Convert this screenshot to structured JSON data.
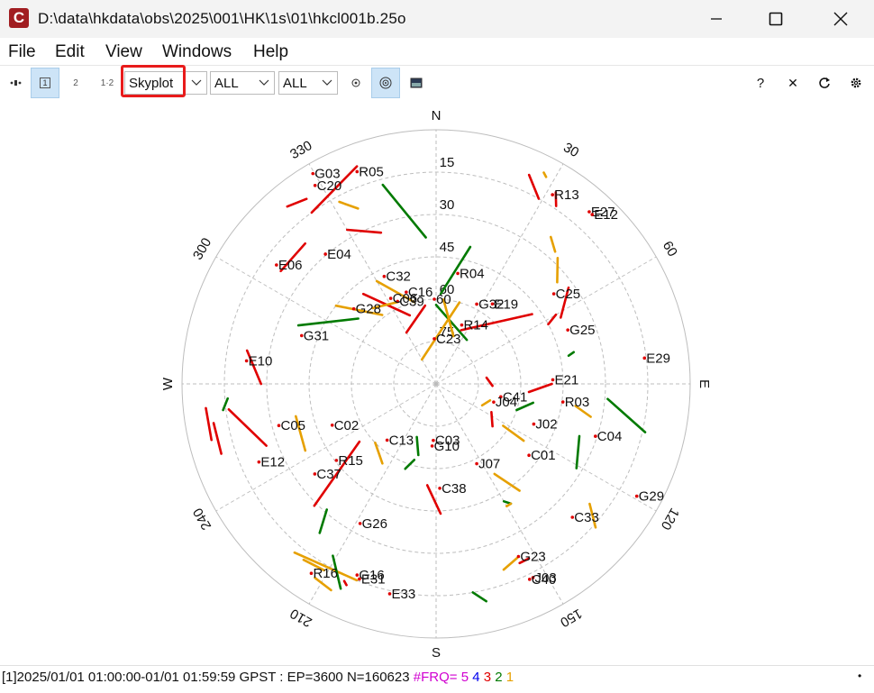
{
  "window": {
    "title": "D:\\data\\hkdata\\obs\\2025\\001\\HK\\1s\\01\\hkcl001b.25o",
    "icon_letter": "C",
    "minimize_icon": "minimize-icon",
    "maximize_icon": "maximize-icon",
    "close_icon": "close-icon"
  },
  "menu": [
    "File",
    "Edit",
    "View",
    "Windows",
    "Help"
  ],
  "toolbar": {
    "btn_1": "1",
    "btn_2": "2",
    "btn_12": "1·2",
    "plot_type": "Skyplot",
    "sat_filter": "ALL",
    "obs_filter": "ALL",
    "help": "?",
    "close": "✕"
  },
  "skyplot": {
    "directions": {
      "N": "N",
      "E": "E",
      "S": "S",
      "W": "W"
    },
    "azimuth_labels": [
      {
        "az": 30,
        "text": "30"
      },
      {
        "az": 60,
        "text": "60"
      },
      {
        "az": 120,
        "text": "120"
      },
      {
        "az": 150,
        "text": "150"
      },
      {
        "az": 210,
        "text": "210"
      },
      {
        "az": 240,
        "text": "240"
      },
      {
        "az": 300,
        "text": "300"
      },
      {
        "az": 330,
        "text": "330"
      }
    ],
    "elevation_labels": [
      {
        "el": 15,
        "text": "15"
      },
      {
        "el": 30,
        "text": "30"
      },
      {
        "el": 45,
        "text": "45"
      },
      {
        "el": 60,
        "text": "60"
      },
      {
        "el": 75,
        "text": "75"
      }
    ],
    "colors": {
      "g1": "#e00000",
      "g2": "#e6a000",
      "g3": "#007a00",
      "grid": "#bdbdbd"
    },
    "tracks": [
      {
        "c": "g1",
        "pts": [
          [
            324,
            15
          ],
          [
            340,
            8
          ]
        ]
      },
      {
        "c": "g2",
        "pts": [
          [
            332,
            17
          ],
          [
            336,
            22
          ]
        ]
      },
      {
        "c": "g1",
        "pts": [
          [
            320,
            8
          ],
          [
            325,
            10
          ]
        ]
      },
      {
        "c": "g3",
        "pts": [
          [
            345,
            17
          ],
          [
            356,
            38
          ]
        ]
      },
      {
        "c": "g1",
        "pts": [
          [
            306,
            22
          ],
          [
            317,
            22
          ]
        ]
      },
      {
        "c": "g1",
        "pts": [
          [
            330,
            27
          ],
          [
            340,
            33
          ]
        ]
      },
      {
        "c": "g1",
        "pts": [
          [
            24,
            9
          ],
          [
            29,
            15
          ]
        ]
      },
      {
        "c": "g2",
        "pts": [
          [
            27,
            6
          ],
          [
            28,
            7
          ]
        ]
      },
      {
        "c": "g1",
        "pts": [
          [
            32,
            10
          ],
          [
            34,
            14
          ]
        ]
      },
      {
        "c": "g2",
        "pts": [
          [
            44,
            28
          ],
          [
            50,
            34
          ]
        ]
      },
      {
        "c": "g2",
        "pts": [
          [
            38,
            24
          ],
          [
            42,
            27
          ]
        ]
      },
      {
        "c": "g1",
        "pts": [
          [
            62,
            40
          ],
          [
            54,
            32
          ]
        ]
      },
      {
        "c": "g1",
        "pts": [
          [
            90,
            49
          ],
          [
            95,
            57
          ]
        ]
      },
      {
        "c": "g3",
        "pts": [
          [
            101,
            55
          ],
          [
            108,
            60
          ]
        ]
      },
      {
        "c": "g3",
        "pts": [
          [
            110,
            36
          ],
          [
            121,
            32
          ]
        ]
      },
      {
        "c": "g2",
        "pts": [
          [
            142,
            42
          ],
          [
            147,
            52
          ]
        ]
      },
      {
        "c": "g3",
        "pts": [
          [
            148,
            40
          ],
          [
            150,
            42
          ]
        ]
      },
      {
        "c": "g3",
        "pts": [
          [
            263,
            14
          ],
          [
            266,
            16
          ]
        ]
      },
      {
        "c": "g1",
        "pts": [
          [
            260,
            10
          ],
          [
            252,
            10
          ]
        ]
      },
      {
        "c": "g3",
        "pts": [
          [
            293,
            37
          ],
          [
            310,
            54
          ]
        ]
      },
      {
        "c": "g1",
        "pts": [
          [
            321,
            49
          ],
          [
            339,
            64
          ]
        ]
      },
      {
        "c": "g2",
        "pts": [
          [
            320,
            55
          ],
          [
            335,
            58
          ]
        ]
      },
      {
        "c": "g2",
        "pts": [
          [
            330,
            48
          ],
          [
            345,
            60
          ]
        ]
      },
      {
        "c": "g1",
        "pts": [
          [
            330,
            69
          ],
          [
            352,
            62
          ]
        ]
      },
      {
        "c": "g3",
        "pts": [
          [
            14,
            40
          ],
          [
            3,
            58
          ]
        ]
      },
      {
        "c": "g3",
        "pts": [
          [
            0,
            62
          ],
          [
            35,
            71
          ]
        ]
      },
      {
        "c": "g1",
        "pts": [
          [
            25,
            69
          ],
          [
            54,
            48
          ]
        ]
      },
      {
        "c": "g1",
        "pts": [
          [
            60,
            41
          ],
          [
            62,
            45
          ]
        ]
      },
      {
        "c": "g2",
        "pts": [
          [
            5,
            60
          ],
          [
            20,
            72
          ]
        ]
      },
      {
        "c": "g2",
        "pts": [
          [
            330,
            80
          ],
          [
            16,
            60
          ]
        ]
      },
      {
        "c": "g2",
        "pts": [
          [
            308,
            45
          ],
          [
            322,
            59
          ]
        ]
      },
      {
        "c": "g1",
        "pts": [
          [
            83,
            72
          ],
          [
            92,
            70
          ]
        ]
      },
      {
        "c": "g2",
        "pts": [
          [
            107,
            70
          ],
          [
            115,
            72
          ]
        ]
      },
      {
        "c": "g1",
        "pts": [
          [
            127,
            65
          ],
          [
            117,
            68
          ]
        ]
      },
      {
        "c": "g2",
        "pts": [
          [
            123,
            53
          ],
          [
            122,
            62
          ]
        ]
      },
      {
        "c": "g1",
        "pts": [
          [
            185,
            54
          ],
          [
            178,
            44
          ]
        ]
      },
      {
        "c": "g3",
        "pts": [
          [
            194,
            64
          ],
          [
            200,
            70
          ]
        ]
      },
      {
        "c": "g3",
        "pts": [
          [
            200,
            58
          ],
          [
            196,
            62
          ]
        ]
      },
      {
        "c": "g2",
        "pts": [
          [
            214,
            56
          ],
          [
            226,
            60
          ]
        ]
      },
      {
        "c": "g1",
        "pts": [
          [
            225,
            29
          ],
          [
            233,
            56
          ]
        ]
      },
      {
        "c": "g2",
        "pts": [
          [
            202,
            15
          ],
          [
            220,
            12
          ]
        ]
      },
      {
        "c": "g2",
        "pts": [
          [
            150,
            40
          ],
          [
            148,
            40
          ]
        ]
      },
      {
        "c": "g2",
        "pts": [
          [
            155,
            22
          ],
          [
            160,
            20
          ]
        ]
      },
      {
        "c": "g1",
        "pts": [
          [
            155,
            20
          ],
          [
            152,
            20
          ]
        ]
      },
      {
        "c": "g3",
        "pts": [
          [
            167,
            11
          ],
          [
            170,
            15
          ]
        ]
      },
      {
        "c": "g2",
        "pts": [
          [
            132,
            14
          ],
          [
            128,
            21
          ]
        ]
      },
      {
        "c": "g3",
        "pts": [
          [
            103,
            14
          ],
          [
            95,
            29
          ]
        ]
      },
      {
        "c": "g2",
        "pts": [
          [
            102,
            34
          ],
          [
            99,
            40
          ]
        ]
      },
      {
        "c": "g3",
        "pts": [
          [
            77,
            40
          ],
          [
            78,
            42
          ]
        ]
      },
      {
        "c": "g2",
        "pts": [
          [
            211,
            13
          ],
          [
            217,
            12
          ]
        ]
      },
      {
        "c": "g3",
        "pts": [
          [
            205,
            10
          ],
          [
            211,
            19
          ]
        ]
      },
      {
        "c": "g1",
        "pts": [
          [
            204,
            12
          ],
          [
            205,
            13
          ]
        ]
      },
      {
        "c": "g3",
        "pts": [
          [
            218,
            23
          ],
          [
            221,
            31
          ]
        ]
      },
      {
        "c": "g1",
        "pts": [
          [
            250,
            26
          ],
          [
            263,
            16
          ]
        ]
      },
      {
        "c": "g2",
        "pts": [
          [
            243,
            38
          ],
          [
            257,
            39
          ]
        ]
      },
      {
        "c": "g2",
        "pts": [
          [
            207,
            8
          ],
          [
            212,
            9
          ]
        ]
      },
      {
        "c": "g1",
        "pts": [
          [
            256,
            8
          ],
          [
            264,
            8
          ]
        ]
      },
      {
        "c": "g1",
        "pts": [
          [
            270,
            28
          ],
          [
            280,
            22
          ]
        ]
      }
    ],
    "labels": [
      {
        "az": 330,
        "el": 4,
        "text": "G03"
      },
      {
        "az": 329,
        "el": 8,
        "text": "C20"
      },
      {
        "az": 340,
        "el": 10,
        "text": "R05"
      },
      {
        "az": 32,
        "el": 11,
        "text": "R13"
      },
      {
        "az": 42,
        "el": 8,
        "text": "E27"
      },
      {
        "az": 43,
        "el": 8,
        "text": "E12"
      },
      {
        "az": 307,
        "el": 20,
        "text": "E06"
      },
      {
        "az": 320,
        "el": 30,
        "text": "E04"
      },
      {
        "az": 53,
        "el": 37,
        "text": "C25"
      },
      {
        "az": 335,
        "el": 48,
        "text": "C32"
      },
      {
        "az": 12,
        "el": 50,
        "text": "R04"
      },
      {
        "az": 336,
        "el": 58,
        "text": "C39"
      },
      {
        "az": 28,
        "el": 58,
        "text": "G32"
      },
      {
        "az": 36,
        "el": 55,
        "text": "E19"
      },
      {
        "az": 0,
        "el": 60,
        "text": "60"
      },
      {
        "az": 343,
        "el": 56,
        "text": "C16"
      },
      {
        "az": 313,
        "el": 51,
        "text": "G28"
      },
      {
        "az": 333,
        "el": 56,
        "text": "C06"
      },
      {
        "az": 68,
        "el": 39,
        "text": "G25"
      },
      {
        "az": 25,
        "el": 67,
        "text": "R14"
      },
      {
        "az": 88,
        "el": 48,
        "text": "E21"
      },
      {
        "az": 0,
        "el": 74,
        "text": "C23"
      },
      {
        "az": 290,
        "el": 40,
        "text": "G31"
      },
      {
        "az": 83,
        "el": 15,
        "text": "E29"
      },
      {
        "az": 277,
        "el": 23,
        "text": "E10"
      },
      {
        "az": 98,
        "el": 44,
        "text": "R03"
      },
      {
        "az": 101,
        "el": 66,
        "text": "C41"
      },
      {
        "az": 107,
        "el": 68,
        "text": "J04"
      },
      {
        "az": 112,
        "el": 52,
        "text": "J02"
      },
      {
        "az": 255,
        "el": 33,
        "text": "C05"
      },
      {
        "az": 248,
        "el": 51,
        "text": "C02"
      },
      {
        "az": 246,
        "el": 22,
        "text": "E12"
      },
      {
        "az": 220,
        "el": 64,
        "text": "C13"
      },
      {
        "az": 182,
        "el": 68,
        "text": "G10"
      },
      {
        "az": 181,
        "el": 70,
        "text": "C03"
      },
      {
        "az": 152,
        "el": 58,
        "text": "J07"
      },
      {
        "az": 127,
        "el": 48,
        "text": "C01"
      },
      {
        "az": 108,
        "el": 30,
        "text": "C04"
      },
      {
        "az": 232,
        "el": 46,
        "text": "R15"
      },
      {
        "az": 233,
        "el": 37,
        "text": "C37"
      },
      {
        "az": 177,
        "el": 53,
        "text": "C38"
      },
      {
        "az": 119,
        "el": 8,
        "text": "G29"
      },
      {
        "az": 208,
        "el": 34,
        "text": "G26"
      },
      {
        "az": 134,
        "el": 22,
        "text": "C33"
      },
      {
        "az": 154,
        "el": 22,
        "text": "G23"
      },
      {
        "az": 153,
        "el": 13,
        "text": "J03"
      },
      {
        "az": 154,
        "el": 13,
        "text": "C40"
      },
      {
        "az": 213,
        "el": 10,
        "text": "R16"
      },
      {
        "az": 202,
        "el": 17,
        "text": "G16"
      },
      {
        "az": 201,
        "el": 16,
        "text": "E31"
      },
      {
        "az": 192,
        "el": 14,
        "text": "E33"
      }
    ]
  },
  "status": {
    "main": "[1]2025/01/01 01:00:00-01/01 01:59:59 GPST : EP=3600 N=160623 ",
    "frq_label": "#FRQ=",
    "f5": "5",
    "f4": "4",
    "f3": "3",
    "f2": "2",
    "f1": "1",
    "c_frq": "#d000d0",
    "c5": "#d000d0",
    "c4": "#0000ee",
    "c3": "#e00000",
    "c2": "#007a00",
    "c1": "#e6a000"
  }
}
